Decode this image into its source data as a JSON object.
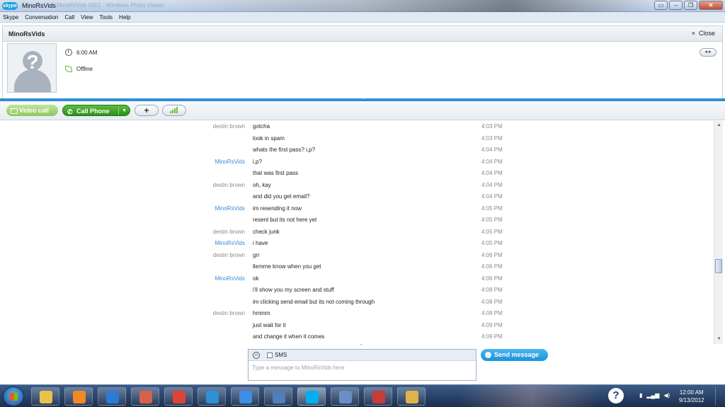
{
  "window": {
    "logo_text": "skype",
    "title": "MinoRsVids",
    "background_title": "MinoRsVids 0001 - Windows Photo Viewer",
    "controls": [
      "▭",
      "–",
      "❐",
      "✕"
    ]
  },
  "menu": [
    "Skype",
    "Conversation",
    "Call",
    "View",
    "Tools",
    "Help"
  ],
  "contact": {
    "name": "MinoRsVids",
    "close_label": "Close",
    "close_glyph": "×",
    "local_time": "6:00 AM",
    "status": "Offline",
    "nav_glyph": "◂ ▸"
  },
  "callbar": {
    "video_call": "Video call",
    "call_phone": "Call Phone",
    "phone_glyph": "✆",
    "dropdown_glyph": "▼",
    "add_glyph": "+"
  },
  "messages": [
    {
      "sender": "destin brown",
      "me": false,
      "text": "gotcha",
      "time": "4:03 PM"
    },
    {
      "sender": "",
      "me": false,
      "text": "look in spam",
      "time": "4:03 PM"
    },
    {
      "sender": "",
      "me": false,
      "text": "whats the first pass? i,p?",
      "time": "4:04 PM"
    },
    {
      "sender": "MinoRsVids",
      "me": true,
      "text": "i,p?",
      "time": "4:04 PM"
    },
    {
      "sender": "",
      "me": true,
      "text": "that was first pass",
      "time": "4:04 PM"
    },
    {
      "sender": "destin brown",
      "me": false,
      "text": "oh, kay",
      "time": "4:04 PM"
    },
    {
      "sender": "",
      "me": false,
      "text": "and did you get email?",
      "time": "4:04 PM"
    },
    {
      "sender": "MinoRsVids",
      "me": true,
      "text": "im resending it now",
      "time": "4:05 PM"
    },
    {
      "sender": "",
      "me": true,
      "text": "resent but its not here yet",
      "time": "4:05 PM"
    },
    {
      "sender": "destin brown",
      "me": false,
      "text": "check junk",
      "time": "4:05 PM"
    },
    {
      "sender": "MinoRsVids",
      "me": true,
      "text": "i have",
      "time": "4:05 PM"
    },
    {
      "sender": "destin brown",
      "me": false,
      "text": "grr",
      "time": "4:06 PM"
    },
    {
      "sender": "",
      "me": false,
      "text": "llemme know when you get",
      "time": "4:06 PM"
    },
    {
      "sender": "MinoRsVids",
      "me": true,
      "text": "ok",
      "time": "4:06 PM"
    },
    {
      "sender": "",
      "me": true,
      "text": "i'll show you my screen and stuff",
      "time": "4:08 PM"
    },
    {
      "sender": "",
      "me": true,
      "text": "im clicking send email but its not coming through",
      "time": "4:08 PM"
    },
    {
      "sender": "destin brown",
      "me": false,
      "text": "hmmm",
      "time": "4:08 PM"
    },
    {
      "sender": "",
      "me": false,
      "text": "just wait for it",
      "time": "4:09 PM"
    },
    {
      "sender": "",
      "me": false,
      "text": "and change it when it comes",
      "time": "4:09 PM"
    }
  ],
  "compose": {
    "sms_label": "SMS",
    "placeholder": "Type a message to MinoRsVids here",
    "send_label": "Send message",
    "smiley_glyph": "☺"
  },
  "taskbar": {
    "apps": [
      {
        "name": "explorer",
        "color": "#e8c24a"
      },
      {
        "name": "media-player",
        "color": "#f08a24"
      },
      {
        "name": "photo-viewer",
        "color": "#2b7cd3"
      },
      {
        "name": "paint",
        "color": "#d9614c"
      },
      {
        "name": "chrome",
        "color": "#db4437"
      },
      {
        "name": "hp",
        "color": "#2f8fd6"
      },
      {
        "name": "itunes",
        "color": "#3d8ee6"
      },
      {
        "name": "desktop",
        "color": "#4f7fb8"
      },
      {
        "name": "skype",
        "color": "#00aff0"
      },
      {
        "name": "quicktime",
        "color": "#6a8fc8"
      },
      {
        "name": "media",
        "color": "#c83b3b"
      },
      {
        "name": "paint-tool",
        "color": "#e2b24a"
      }
    ],
    "help_glyph": "?",
    "clock_time": "12:00 AM",
    "clock_date": "9/13/2012"
  }
}
